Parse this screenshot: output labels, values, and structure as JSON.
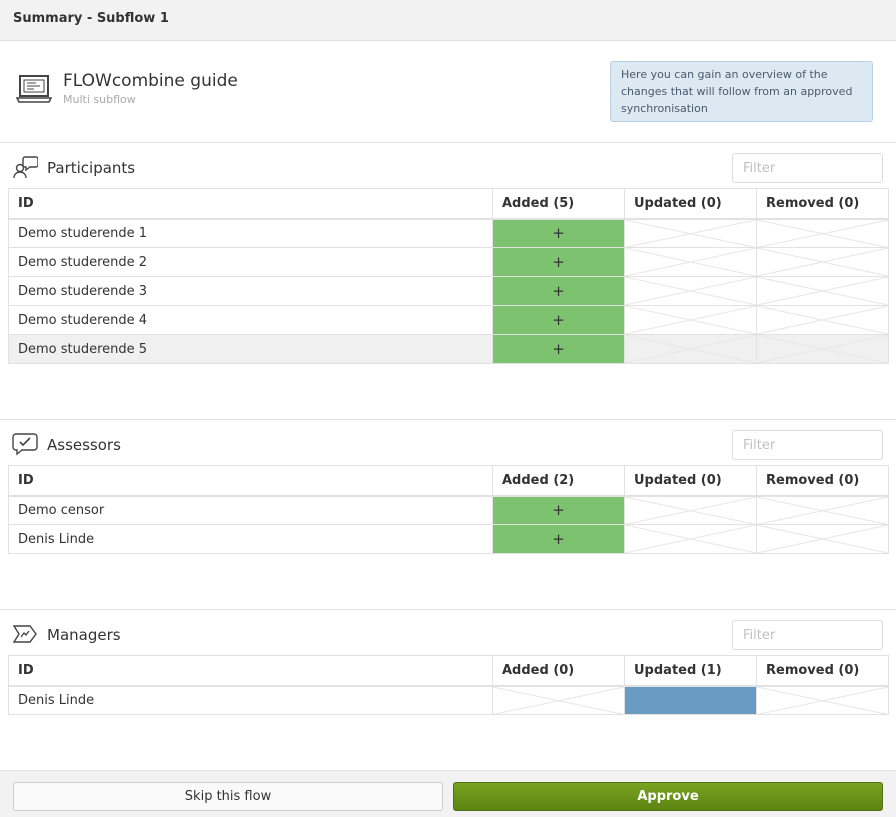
{
  "window": {
    "title": "Summary - Subflow 1"
  },
  "flow": {
    "icon": "laptop-icon",
    "title": "FLOWcombine guide",
    "subtitle": "Multi subflow",
    "hint": "Here you can gain an overview of the changes that will follow from an approved synchronisation"
  },
  "columns": {
    "id": "ID"
  },
  "participants": {
    "title": "Participants",
    "icon": "participants-icon",
    "filter_placeholder": "Filter",
    "headers": {
      "id": "ID",
      "added": "Added (5)",
      "updated": "Updated (0)",
      "removed": "Removed (0)"
    },
    "rows": [
      {
        "id": "Demo studerende 1",
        "added": "+"
      },
      {
        "id": "Demo studerende 2",
        "added": "+"
      },
      {
        "id": "Demo studerende 3",
        "added": "+"
      },
      {
        "id": "Demo studerende 4",
        "added": "+"
      },
      {
        "id": "Demo studerende 5",
        "added": "+"
      }
    ]
  },
  "assessors": {
    "title": "Assessors",
    "icon": "assessors-icon",
    "filter_placeholder": "Filter",
    "headers": {
      "id": "ID",
      "added": "Added (2)",
      "updated": "Updated (0)",
      "removed": "Removed (0)"
    },
    "rows": [
      {
        "id": "Demo censor",
        "added": "+"
      },
      {
        "id": "Denis Linde",
        "added": "+"
      }
    ]
  },
  "managers": {
    "title": "Managers",
    "icon": "managers-icon",
    "filter_placeholder": "Filter",
    "headers": {
      "id": "ID",
      "added": "Added (0)",
      "updated": "Updated (1)",
      "removed": "Removed (0)"
    },
    "rows": [
      {
        "id": "Denis Linde"
      }
    ]
  },
  "footer": {
    "skip_label": "Skip this flow",
    "approve_label": "Approve"
  },
  "colors": {
    "added": "#7dc36f",
    "updated": "#6a9bc3",
    "approve": "#6b9319",
    "hint_bg": "#dce8f2"
  }
}
